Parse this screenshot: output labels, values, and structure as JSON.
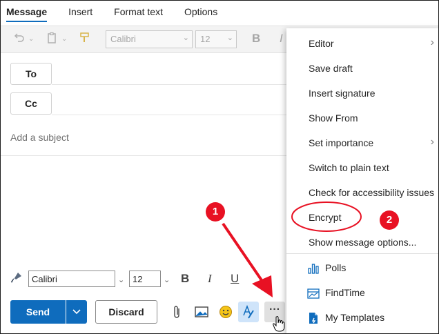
{
  "tabs": [
    {
      "label": "Message",
      "active": true
    },
    {
      "label": "Insert",
      "active": false
    },
    {
      "label": "Format text",
      "active": false
    },
    {
      "label": "Options",
      "active": false
    }
  ],
  "ribbon": {
    "font": "Calibri",
    "size": "12",
    "bold_glyph": "B",
    "italic_glyph": "I"
  },
  "recipients": {
    "to_label": "To",
    "cc_label": "Cc"
  },
  "subject": {
    "placeholder": "Add a subject"
  },
  "format_toolbar": {
    "font": "Calibri",
    "size": "12",
    "bold_glyph": "B",
    "italic_glyph": "I",
    "underline_glyph": "U"
  },
  "actions": {
    "send_label": "Send",
    "discard_label": "Discard",
    "more_glyph": "···"
  },
  "menu": {
    "items": [
      {
        "label": "Editor",
        "submenu": true
      },
      {
        "label": "Save draft"
      },
      {
        "label": "Insert signature"
      },
      {
        "label": "Show From"
      },
      {
        "label": "Set importance",
        "submenu": true
      },
      {
        "label": "Switch to plain text"
      },
      {
        "label": "Check for accessibility issues"
      },
      {
        "label": "Encrypt",
        "highlighted": true
      },
      {
        "label": "Show message options..."
      }
    ],
    "addins": [
      {
        "label": "Polls",
        "icon": "polls-icon"
      },
      {
        "label": "FindTime",
        "icon": "findtime-icon"
      },
      {
        "label": "My Templates",
        "icon": "templates-icon"
      }
    ]
  },
  "annotations": {
    "step1": "1",
    "step2": "2"
  },
  "colors": {
    "accent": "#0f6cbd",
    "annotation": "#e81123"
  }
}
